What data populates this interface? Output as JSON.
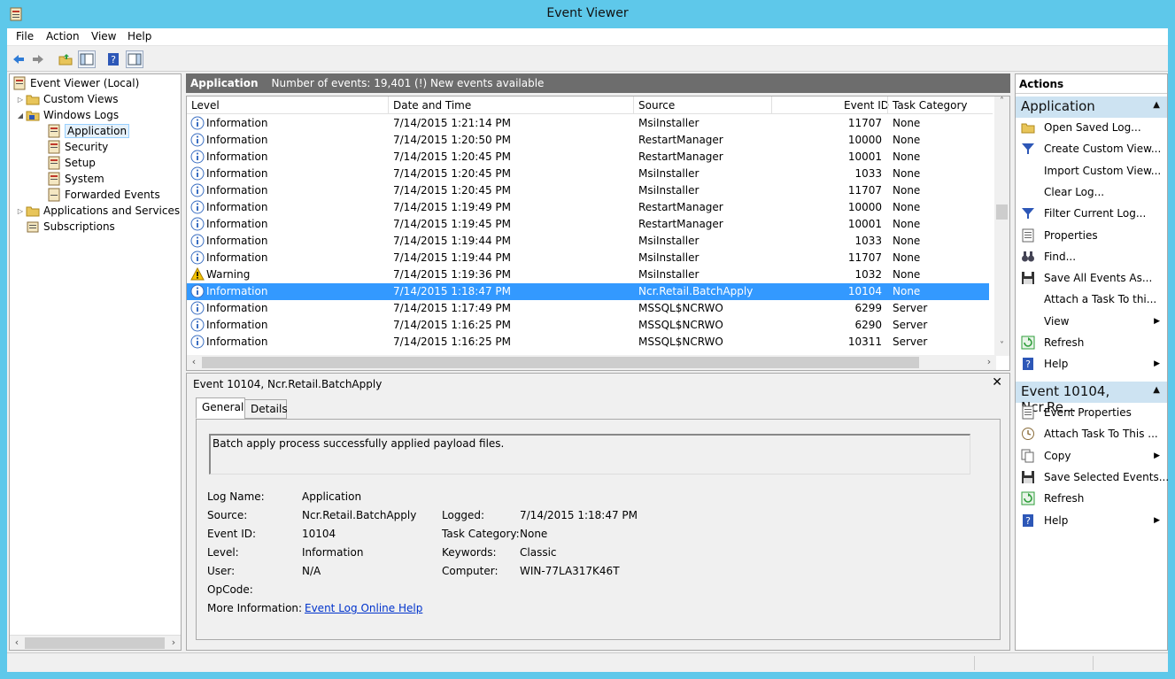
{
  "window": {
    "title": "Event Viewer"
  },
  "menu": [
    "File",
    "Action",
    "View",
    "Help"
  ],
  "toolbar": {
    "buttons": [
      "back-icon",
      "forward-icon",
      "up-folder-icon",
      "show-hide-console-tree-icon",
      "help-icon",
      "show-hide-action-pane-icon"
    ]
  },
  "tree": {
    "root": "Event Viewer (Local)",
    "custom_views": "Custom Views",
    "windows_logs": "Windows Logs",
    "logs": [
      "Application",
      "Security",
      "Setup",
      "System",
      "Forwarded Events"
    ],
    "app_services": "Applications and Services Lo",
    "subscriptions": "Subscriptions"
  },
  "list": {
    "name": "Application",
    "summary": "Number of events: 19,401 (!) New events available",
    "columns": [
      "Level",
      "Date and Time",
      "Source",
      "Event ID",
      "Task Category"
    ],
    "rows": [
      {
        "level": "Information",
        "date": "7/14/2015 1:21:14 PM",
        "source": "MsiInstaller",
        "id": "11707",
        "cat": "None"
      },
      {
        "level": "Information",
        "date": "7/14/2015 1:20:50 PM",
        "source": "RestartManager",
        "id": "10000",
        "cat": "None"
      },
      {
        "level": "Information",
        "date": "7/14/2015 1:20:45 PM",
        "source": "RestartManager",
        "id": "10001",
        "cat": "None"
      },
      {
        "level": "Information",
        "date": "7/14/2015 1:20:45 PM",
        "source": "MsiInstaller",
        "id": "1033",
        "cat": "None"
      },
      {
        "level": "Information",
        "date": "7/14/2015 1:20:45 PM",
        "source": "MsiInstaller",
        "id": "11707",
        "cat": "None"
      },
      {
        "level": "Information",
        "date": "7/14/2015 1:19:49 PM",
        "source": "RestartManager",
        "id": "10000",
        "cat": "None"
      },
      {
        "level": "Information",
        "date": "7/14/2015 1:19:45 PM",
        "source": "RestartManager",
        "id": "10001",
        "cat": "None"
      },
      {
        "level": "Information",
        "date": "7/14/2015 1:19:44 PM",
        "source": "MsiInstaller",
        "id": "1033",
        "cat": "None"
      },
      {
        "level": "Information",
        "date": "7/14/2015 1:19:44 PM",
        "source": "MsiInstaller",
        "id": "11707",
        "cat": "None"
      },
      {
        "level": "Warning",
        "date": "7/14/2015 1:19:36 PM",
        "source": "MsiInstaller",
        "id": "1032",
        "cat": "None"
      },
      {
        "level": "Information",
        "date": "7/14/2015 1:18:47 PM",
        "source": "Ncr.Retail.BatchApply",
        "id": "10104",
        "cat": "None"
      },
      {
        "level": "Information",
        "date": "7/14/2015 1:17:49 PM",
        "source": "MSSQL$NCRWO",
        "id": "6299",
        "cat": "Server"
      },
      {
        "level": "Information",
        "date": "7/14/2015 1:16:25 PM",
        "source": "MSSQL$NCRWO",
        "id": "6290",
        "cat": "Server"
      },
      {
        "level": "Information",
        "date": "7/14/2015 1:16:25 PM",
        "source": "MSSQL$NCRWO",
        "id": "10311",
        "cat": "Server"
      }
    ]
  },
  "detail": {
    "title": "Event 10104, Ncr.Retail.BatchApply",
    "close": "✕",
    "tabs": [
      "General",
      "Details"
    ],
    "message": "Batch apply process successfully applied payload files.",
    "labels": {
      "log_name": "Log Name:",
      "source": "Source:",
      "event_id": "Event ID:",
      "level": "Level:",
      "user": "User:",
      "opcode": "OpCode:",
      "more_info": "More Information:",
      "logged": "Logged:",
      "task_category": "Task Category:",
      "keywords": "Keywords:",
      "computer": "Computer:"
    },
    "values": {
      "log_name": "Application",
      "source": "Ncr.Retail.BatchApply",
      "event_id": "10104",
      "level": "Information",
      "user": "N/A",
      "opcode": "",
      "more_info": "Event Log Online Help",
      "logged": "7/14/2015 1:18:47 PM",
      "task_category": "None",
      "keywords": "Classic",
      "computer": "WIN-77LA317K46T"
    }
  },
  "actions": {
    "header": "Actions",
    "section1": "Application",
    "items1": [
      {
        "label": "Open Saved Log...",
        "icon": "folder-open-icon"
      },
      {
        "label": "Create Custom View...",
        "icon": "filter-icon"
      },
      {
        "label": "Import Custom View...",
        "icon": ""
      },
      {
        "label": "Clear Log...",
        "icon": ""
      },
      {
        "label": "Filter Current Log...",
        "icon": "filter-icon"
      },
      {
        "label": "Properties",
        "icon": "properties-icon"
      },
      {
        "label": "Find...",
        "icon": "binoculars-icon"
      },
      {
        "label": "Save All Events As...",
        "icon": "save-icon"
      },
      {
        "label": "Attach a Task To thi...",
        "icon": ""
      },
      {
        "label": "View",
        "icon": "",
        "submenu": true
      },
      {
        "label": "Refresh",
        "icon": "refresh-icon"
      },
      {
        "label": "Help",
        "icon": "help-icon",
        "submenu": true
      }
    ],
    "section2": "Event 10104, Ncr.Re...",
    "items2": [
      {
        "label": "Event Properties",
        "icon": "properties-icon"
      },
      {
        "label": "Attach Task To This ...",
        "icon": "task-clock-icon"
      },
      {
        "label": "Copy",
        "icon": "copy-icon",
        "submenu": true
      },
      {
        "label": "Save Selected Events...",
        "icon": "save-icon"
      },
      {
        "label": "Refresh",
        "icon": "refresh-icon"
      },
      {
        "label": "Help",
        "icon": "help-icon",
        "submenu": true
      }
    ]
  },
  "colors": {
    "titlebar": "#5ec8ea",
    "selection": "#3399ff",
    "section": "#cde3f2",
    "list_header": "#6d6d6d"
  }
}
